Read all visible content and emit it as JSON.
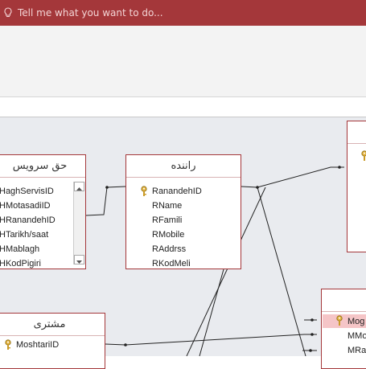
{
  "ribbon": {
    "tell_me_placeholder": "Tell me what you want to do..."
  },
  "tables": {
    "hagh_servis": {
      "title": "حق سرویس",
      "fields": [
        "HaghServisID",
        "HMotasadiID",
        "HRanandehID",
        "HTarikh/saat",
        "HMablagh",
        "HKodPigiri"
      ]
    },
    "ranandeh": {
      "title": "راننده",
      "fields": [
        "RanandehID",
        "RName",
        "RFamili",
        "RMobile",
        "RAddrss",
        "RKodMeli"
      ]
    },
    "moshtari": {
      "title": "مشتری",
      "fields": [
        "MoshtariID"
      ]
    },
    "right_table": {
      "fields": [
        "Mog",
        "MMo",
        "MRa"
      ]
    }
  },
  "colors": {
    "accent": "#a4373a",
    "canvas": "#e9ebef",
    "highlight": "#f5c5c7"
  }
}
